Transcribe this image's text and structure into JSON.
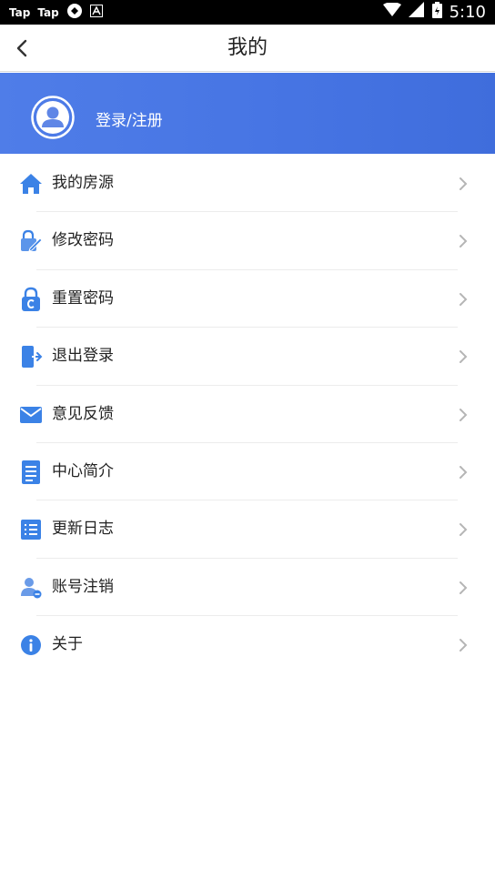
{
  "statusbar": {
    "app1": "Tap",
    "app2": "Tap",
    "time": "5:10"
  },
  "header": {
    "title": "我的"
  },
  "profile": {
    "login_label": "登录/注册"
  },
  "menu": [
    {
      "label": "我的房源",
      "icon": "home-icon"
    },
    {
      "label": "修改密码",
      "icon": "edit-lock-icon"
    },
    {
      "label": "重置密码",
      "icon": "reset-lock-icon"
    },
    {
      "label": "退出登录",
      "icon": "logout-icon"
    },
    {
      "label": "意见反馈",
      "icon": "mail-icon"
    },
    {
      "label": "中心简介",
      "icon": "document-icon"
    },
    {
      "label": "更新日志",
      "icon": "list-icon"
    },
    {
      "label": "账号注销",
      "icon": "user-remove-icon"
    },
    {
      "label": "关于",
      "icon": "info-icon"
    }
  ],
  "colors": {
    "accent": "#4a78e6",
    "icon_blue": "#3b82e6",
    "chevron": "#b5b5b5"
  }
}
